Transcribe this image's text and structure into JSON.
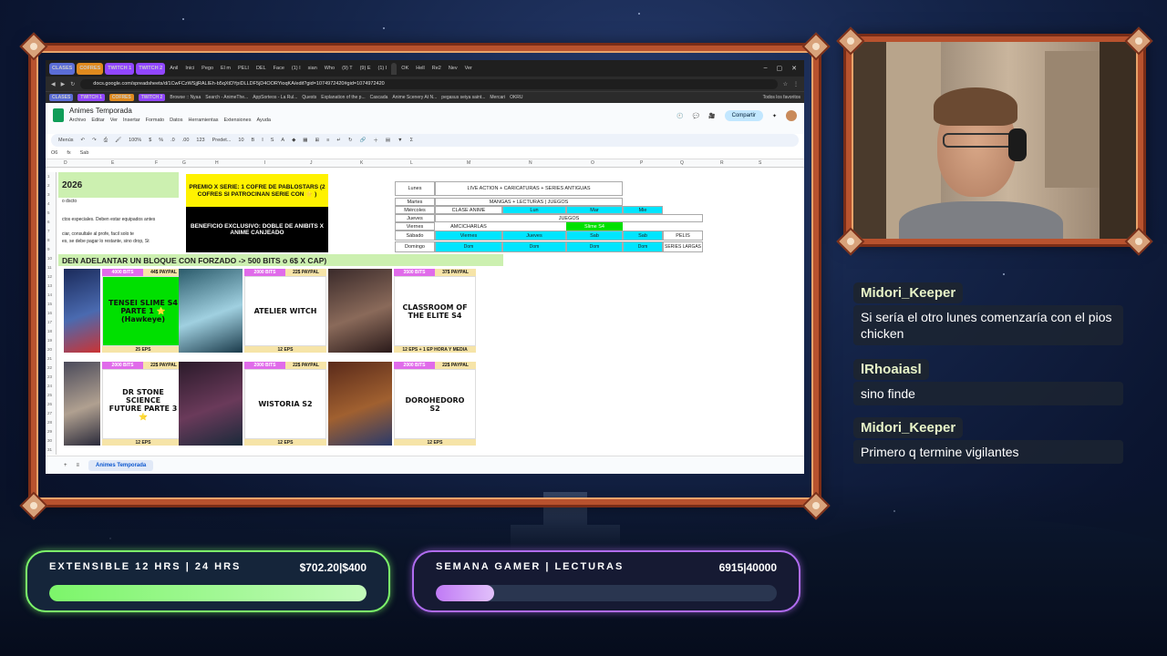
{
  "browser": {
    "tabs": [
      "CLASES",
      "COFRES",
      "TWITCH 1",
      "TWITCH 2",
      "Anil",
      "Inici",
      "Pego",
      "El m",
      "PELI",
      "DEL",
      "Face",
      "(1) I",
      "sian",
      "Who",
      "(9) T",
      "(9) E",
      "(1) I",
      "",
      "OK",
      "Hell",
      "Re2",
      "Nev",
      "Ver"
    ],
    "tab_colors": {
      "clases": "#5b6dd6",
      "cofres": "#e08a1e",
      "twitch1": "#9146ff",
      "twitch2": "#9146ff"
    },
    "url": "docs.google.com/spreadsheets/d/1CwFCzWSjjRALIEh-b5qXtDYpiDLLDF5jD4OORYioqKA/edit?gid=1074972420#gid=1074972420",
    "bookmarks": [
      "CLASES",
      "TWITCH 1",
      "COFRES",
      "TWITCH 2",
      "Browse :: Nyaa",
      "Search - AnimeThe...",
      "AppSorteos - La Rul...",
      "Quests",
      "Explanation of the p...",
      "Cascada",
      "Anime Scenery At N...",
      "pegasus seiya saint...",
      "Mercari",
      "OKRU"
    ],
    "bookmarks_all": "Todos los favoritos"
  },
  "sheets": {
    "title": "Animes Temporada",
    "menus": [
      "Archivo",
      "Editar",
      "Ver",
      "Insertar",
      "Formato",
      "Datos",
      "Herramientas",
      "Extensiones",
      "Ayuda"
    ],
    "share": "Compartir",
    "toolbar": [
      "Menús",
      "100%",
      "$",
      "%",
      ".0",
      ".00",
      "123",
      "Predet...",
      "10"
    ],
    "cell_ref": "O6",
    "formula_value": "Sab",
    "columns": [
      "D",
      "E",
      "F",
      "G",
      "H",
      "I",
      "J",
      "K",
      "L",
      "M",
      "N",
      "O",
      "P",
      "Q",
      "R",
      "S"
    ],
    "rows": [
      "1",
      "2",
      "3",
      "4",
      "5",
      "6",
      "7",
      "8",
      "9",
      "10",
      "11",
      "12",
      "13",
      "14",
      "15",
      "16",
      "17",
      "18",
      "19",
      "20",
      "21",
      "22",
      "23",
      "24",
      "25",
      "26",
      "27",
      "28",
      "29",
      "30",
      "31"
    ],
    "year": "2026",
    "left_text": [
      "o dscto",
      "ctos especiales. Deben estar equipados antes",
      "ciar, consultale al profe, facil solo te",
      "es, se debe pagar lo restante, sino drop, St"
    ],
    "premio": "PREMIO X SERIE: 1 COFRE DE PABLOSTARS (2 COFRES SI PATROCINAN SERIE CON ⭐ )",
    "beneficio": "BENEFICIO EXCLUSIVO: DOBLE DE ANIBITS X ANIME CANJEADO",
    "schedule": {
      "days": [
        "Lunes",
        "Martes",
        "Miércoles",
        "Jueves",
        "Viernes",
        "Sábado",
        "Domingo"
      ],
      "lunes": "LIVE ACTION + CARICATURAS + SERIES ANTIGUAS",
      "martes": "MANGAS + LECTURAS | JUEGOS",
      "miercoles": [
        "CLASE ANIME",
        "Lun",
        "Mar",
        "Mie"
      ],
      "jueves": "JUEGOS",
      "viernes": [
        "AMCICHARLAS",
        "Slime S4"
      ],
      "sabado": [
        "Viernes",
        "Jueves",
        "Sab",
        "Sab",
        "PELIS"
      ],
      "domingo": [
        "Dom",
        "Dom",
        "Dom",
        "Dom",
        "SERIES LARGAS"
      ]
    },
    "headline": "DEN ADELANTAR UN BLOQUE CON FORZADO -> 500 BITS o 6$ X CAP)",
    "cards": [
      {
        "bits": "4000 BITS",
        "paypal": "44$ PAYPAL",
        "title": "TENSEI SLIME S4 PARTE 1 ⭐ (Hawkeye)",
        "eps": "25 EPS",
        "bg": "#00e000"
      },
      {
        "bits": "2000 BITS",
        "paypal": "22$ PAYPAL",
        "title": "ATELIER WITCH",
        "eps": "12 EPS",
        "bg": "#ffffff"
      },
      {
        "bits": "3500 BITS",
        "paypal": "37$ PAYPAL",
        "title": "CLASSROOM OF THE ELITE S4",
        "eps": "12 EPS + 1 EP HORA Y MEDIA",
        "bg": "#ffffff"
      },
      {
        "bits": "2000 BITS",
        "paypal": "22$ PAYPAL",
        "title": "DR STONE SCIENCE FUTURE PARTE 3 ⭐",
        "eps": "12 EPS",
        "bg": "#ffffff"
      },
      {
        "bits": "2000 BITS",
        "paypal": "22$ PAYPAL",
        "title": "WISTORIA S2",
        "eps": "12 EPS",
        "bg": "#ffffff"
      },
      {
        "bits": "2000 BITS",
        "paypal": "22$ PAYPAL",
        "title": "DOROHEDORO S2",
        "eps": "12 EPS",
        "bg": "#ffffff"
      }
    ],
    "sheet_tab": "Animes Temporada"
  },
  "chat": [
    {
      "user": "Midori_Keeper",
      "text": "Si sería el otro lunes comenzaría con el pios chicken"
    },
    {
      "user": "lRhoaiasl",
      "text": "sino finde"
    },
    {
      "user": "Midori_Keeper",
      "text": "Primero q termine vigilantes"
    }
  ],
  "goals": [
    {
      "label": "EXTENSIBLE 12 HRS | 24 HRS",
      "value": "$702.20|$400",
      "progress": 1.0,
      "color": "#7cf56a"
    },
    {
      "label": "SEMANA GAMER | LECTURAS",
      "value": "6915|40000",
      "progress": 0.17,
      "color": "#c07af5"
    }
  ]
}
